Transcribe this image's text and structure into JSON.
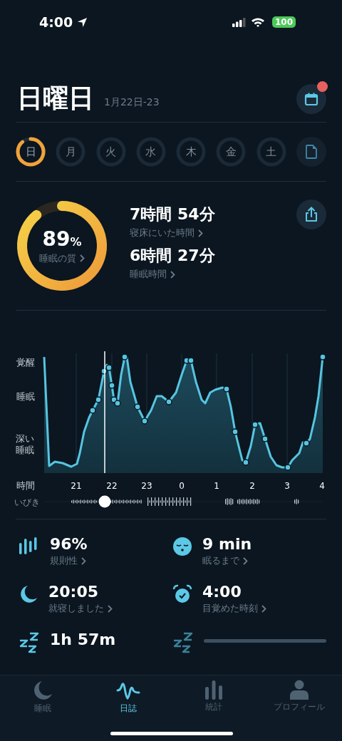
{
  "status_bar": {
    "time": "4:00",
    "battery": "100"
  },
  "header": {
    "title": "日曜日",
    "date": "1月22日-23",
    "calendar_badge": true
  },
  "days": [
    {
      "label": "日",
      "selected": true
    },
    {
      "label": "月",
      "selected": false
    },
    {
      "label": "火",
      "selected": false
    },
    {
      "label": "水",
      "selected": false
    },
    {
      "label": "木",
      "selected": false
    },
    {
      "label": "金",
      "selected": false
    },
    {
      "label": "土",
      "selected": false
    }
  ],
  "summary": {
    "quality": {
      "value": "89",
      "unit": "%",
      "label": "睡眠の質"
    },
    "stats": [
      {
        "value": "7時間 54分",
        "label": "寝床にいた時間"
      },
      {
        "value": "6時間 27分",
        "label": "睡眠時間"
      }
    ]
  },
  "chart": {
    "stage_labels": [
      "覚醒",
      "睡眠",
      "深い睡眠"
    ],
    "axis_label": "時間",
    "hours": [
      "21",
      "22",
      "23",
      "0",
      "1",
      "2",
      "3",
      "4"
    ],
    "snore_label": "いびき"
  },
  "metrics": [
    {
      "kind": "regularity",
      "value": "96%",
      "label": "規則性",
      "loading": false
    },
    {
      "kind": "sleepy",
      "value": "9 min",
      "label": "眠るまで",
      "loading": false
    },
    {
      "kind": "moon",
      "value": "20:05",
      "label": "就寝しました",
      "loading": false
    },
    {
      "kind": "alarm",
      "value": "4:00",
      "label": "目覚めた時刻",
      "loading": false
    },
    {
      "kind": "zzz",
      "value": "1h 57m",
      "loading": false
    },
    {
      "kind": "zzz",
      "loading": true
    }
  ],
  "tabs": [
    {
      "kind": "moon",
      "label": "睡眠",
      "selected": false
    },
    {
      "kind": "wave",
      "label": "日誌",
      "selected": true
    },
    {
      "kind": "bars",
      "label": "統計",
      "selected": false
    },
    {
      "kind": "person",
      "label": "プロフィール",
      "selected": false
    }
  ]
}
